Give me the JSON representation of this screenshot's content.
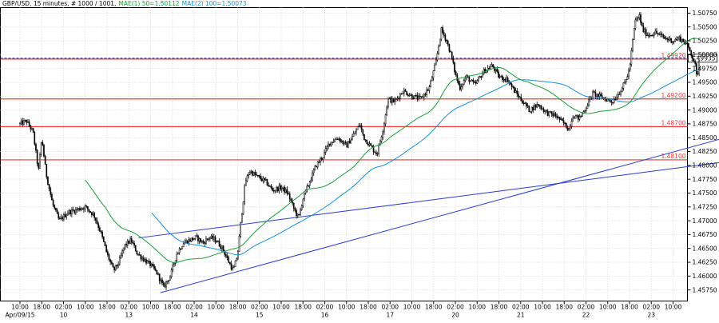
{
  "chart_data": {
    "type": "candlestick",
    "header": {
      "symbol": "GBP/USD",
      "info": ", 15 minutes, # 1000 / 1001,",
      "mae1": "MAE(1) 50=1.50112",
      "mae2": "MAE(2) 100=1.50073"
    },
    "colors": {
      "candle": "#000000",
      "mae1": "#1a9e3a",
      "mae2": "#1a8fd0",
      "levels": "#e83a3a",
      "trendlines": "#2a3cc8",
      "current_price": "#1a1aa0"
    },
    "y_axis": {
      "min": 1.4555,
      "max": 1.5085,
      "ticks": [
        "1.50750",
        "1.50500",
        "1.50250",
        "1.50000",
        "1.49750",
        "1.49500",
        "1.49250",
        "1.49000",
        "1.48750",
        "1.48500",
        "1.48250",
        "1.48000",
        "1.47750",
        "1.47500",
        "1.47250",
        "1.47000",
        "1.46750",
        "1.46500",
        "1.46250",
        "1.46000",
        "1.45750"
      ]
    },
    "x_axis": {
      "ticks": [
        {
          "top": "10:00",
          "bottom": "Apr/09/15"
        },
        {
          "top": "18:00",
          "bottom": ""
        },
        {
          "top": "02:00",
          "bottom": "10"
        },
        {
          "top": "10:00",
          "bottom": ""
        },
        {
          "top": "18:00",
          "bottom": ""
        },
        {
          "top": "02:00",
          "bottom": "13"
        },
        {
          "top": "10:00",
          "bottom": ""
        },
        {
          "top": "18:00",
          "bottom": ""
        },
        {
          "top": "02:00",
          "bottom": "14"
        },
        {
          "top": "10:00",
          "bottom": ""
        },
        {
          "top": "18:00",
          "bottom": ""
        },
        {
          "top": "02:00",
          "bottom": "15"
        },
        {
          "top": "10:00",
          "bottom": ""
        },
        {
          "top": "18:00",
          "bottom": ""
        },
        {
          "top": "02:00",
          "bottom": "16"
        },
        {
          "top": "10:00",
          "bottom": ""
        },
        {
          "top": "18:00",
          "bottom": ""
        },
        {
          "top": "02:00",
          "bottom": "17"
        },
        {
          "top": "10:00",
          "bottom": ""
        },
        {
          "top": "18:00",
          "bottom": ""
        },
        {
          "top": "02:00",
          "bottom": "20"
        },
        {
          "top": "10:00",
          "bottom": ""
        },
        {
          "top": "18:00",
          "bottom": ""
        },
        {
          "top": "02:00",
          "bottom": "21"
        },
        {
          "top": "10:00",
          "bottom": ""
        },
        {
          "top": "18:00",
          "bottom": ""
        },
        {
          "top": "02:00",
          "bottom": "22"
        },
        {
          "top": "10:00",
          "bottom": ""
        },
        {
          "top": "18:00",
          "bottom": ""
        },
        {
          "top": "02:00",
          "bottom": "23"
        },
        {
          "top": "10:00",
          "bottom": ""
        }
      ]
    },
    "levels": [
      {
        "price": 1.4992,
        "label": "1.49920"
      },
      {
        "price": 1.492,
        "label": "1.49200"
      },
      {
        "price": 1.487,
        "label": "1.48700"
      },
      {
        "price": 1.481,
        "label": "1.48100"
      }
    ],
    "current_price": {
      "price": 1.49935,
      "label": "1.49935"
    },
    "trendlines": [
      {
        "x1": 5.45,
        "y1": 1.4669,
        "x2": 32.4,
        "y2": 1.48065
      },
      {
        "x1": 6.45,
        "y1": 1.457,
        "x2": 32.4,
        "y2": 1.485
      }
    ],
    "price_path": [
      [
        0,
        1.4875
      ],
      [
        0.3,
        1.488
      ],
      [
        0.6,
        1.486
      ],
      [
        0.85,
        1.479
      ],
      [
        1.0,
        1.485
      ],
      [
        1.2,
        1.4785
      ],
      [
        1.5,
        1.473
      ],
      [
        1.8,
        1.47
      ],
      [
        2.2,
        1.4715
      ],
      [
        2.6,
        1.472
      ],
      [
        3.0,
        1.4725
      ],
      [
        3.4,
        1.471
      ],
      [
        3.7,
        1.468
      ],
      [
        4.0,
        1.464
      ],
      [
        4.3,
        1.461
      ],
      [
        4.55,
        1.4625
      ],
      [
        4.8,
        1.4655
      ],
      [
        5.1,
        1.4665
      ],
      [
        5.4,
        1.464
      ],
      [
        5.7,
        1.463
      ],
      [
        6.0,
        1.462
      ],
      [
        6.3,
        1.4605
      ],
      [
        6.6,
        1.458
      ],
      [
        6.9,
        1.46
      ],
      [
        7.2,
        1.464
      ],
      [
        7.5,
        1.466
      ],
      [
        7.8,
        1.4665
      ],
      [
        8.1,
        1.467
      ],
      [
        8.4,
        1.466
      ],
      [
        8.7,
        1.467
      ],
      [
        9.0,
        1.4665
      ],
      [
        9.3,
        1.465
      ],
      [
        9.6,
        1.4625
      ],
      [
        9.8,
        1.461
      ],
      [
        10.0,
        1.464
      ],
      [
        10.15,
        1.47
      ],
      [
        10.35,
        1.477
      ],
      [
        10.55,
        1.479
      ],
      [
        10.9,
        1.478
      ],
      [
        11.3,
        1.477
      ],
      [
        11.6,
        1.4755
      ],
      [
        12.0,
        1.476
      ],
      [
        12.3,
        1.475
      ],
      [
        12.6,
        1.472
      ],
      [
        12.8,
        1.4705
      ],
      [
        13.0,
        1.474
      ],
      [
        13.3,
        1.477
      ],
      [
        13.6,
        1.48
      ],
      [
        13.9,
        1.4815
      ],
      [
        14.2,
        1.484
      ],
      [
        14.6,
        1.485
      ],
      [
        15.0,
        1.4835
      ],
      [
        15.4,
        1.486
      ],
      [
        15.6,
        1.4875
      ],
      [
        15.8,
        1.485
      ],
      [
        16.2,
        1.483
      ],
      [
        16.4,
        1.482
      ],
      [
        16.7,
        1.487
      ],
      [
        16.9,
        1.492
      ],
      [
        17.2,
        1.4915
      ],
      [
        17.6,
        1.4935
      ],
      [
        18.0,
        1.4925
      ],
      [
        18.4,
        1.492
      ],
      [
        18.8,
        1.494
      ],
      [
        19.1,
        1.4985
      ],
      [
        19.35,
        1.5045
      ],
      [
        19.6,
        1.5025
      ],
      [
        19.8,
        1.5
      ],
      [
        20.0,
        1.4965
      ],
      [
        20.2,
        1.494
      ],
      [
        20.5,
        1.496
      ],
      [
        20.9,
        1.4945
      ],
      [
        21.3,
        1.497
      ],
      [
        21.7,
        1.498
      ],
      [
        22.0,
        1.496
      ],
      [
        22.4,
        1.4955
      ],
      [
        22.7,
        1.4935
      ],
      [
        23.0,
        1.492
      ],
      [
        23.4,
        1.49
      ],
      [
        23.8,
        1.491
      ],
      [
        24.2,
        1.4895
      ],
      [
        24.6,
        1.489
      ],
      [
        25.0,
        1.4875
      ],
      [
        25.2,
        1.4865
      ],
      [
        25.4,
        1.489
      ],
      [
        25.7,
        1.4885
      ],
      [
        26.0,
        1.4905
      ],
      [
        26.3,
        1.493
      ],
      [
        26.6,
        1.4925
      ],
      [
        26.9,
        1.492
      ],
      [
        27.2,
        1.4915
      ],
      [
        27.5,
        1.493
      ],
      [
        27.8,
        1.495
      ],
      [
        28.0,
        1.4975
      ],
      [
        28.25,
        1.506
      ],
      [
        28.45,
        1.507
      ],
      [
        28.6,
        1.5045
      ],
      [
        28.85,
        1.5035
      ],
      [
        29.2,
        1.504
      ],
      [
        29.6,
        1.503
      ],
      [
        30.0,
        1.5025
      ],
      [
        30.3,
        1.503
      ],
      [
        30.6,
        1.502
      ],
      [
        30.8,
        1.5005
      ],
      [
        31.0,
        1.4985
      ],
      [
        31.1,
        1.4955
      ],
      [
        31.2,
        1.499
      ]
    ]
  }
}
